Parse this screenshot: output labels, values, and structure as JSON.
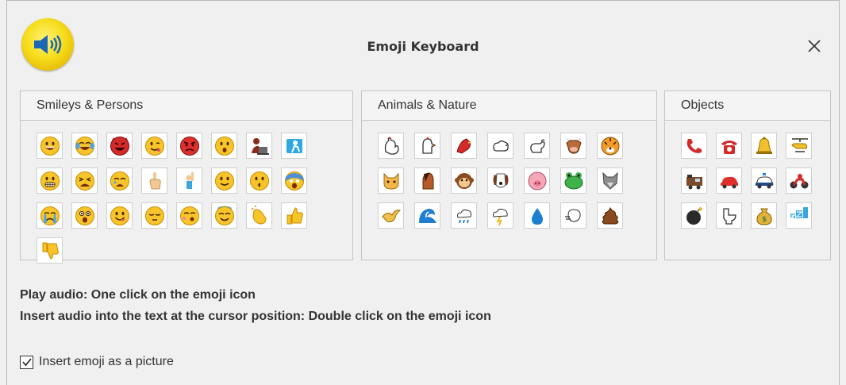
{
  "window": {
    "title": "Emoji Keyboard"
  },
  "panels": {
    "smileys": {
      "label": "Smileys & Persons",
      "items": [
        "grinning-face",
        "face-with-tears-of-joy",
        "smiling-face-with-horns",
        "winking-face",
        "angry-face",
        "hushed-face",
        "person-with-laptop",
        "person-walking",
        "grimacing-face",
        "tired-face",
        "weary-face",
        "raised-finger",
        "person-raising-hand",
        "slightly-smiling-face",
        "face-blowing-kiss",
        "face-screaming-in-fear",
        "crying-face",
        "astonished-face",
        "face-savoring-food",
        "pensive-face",
        "kissing-face",
        "smiling-face-with-halo",
        "clapping-hands",
        "thumbs-up",
        "thumbs-down"
      ]
    },
    "animals": {
      "label": "Animals & Nature",
      "items": [
        "rooster",
        "chicken",
        "cardinal-bird",
        "sheep",
        "goat",
        "cow",
        "tiger",
        "cat-face",
        "horse-face",
        "monkey-face",
        "dog-face",
        "pig-face",
        "frog-face",
        "wolf-face",
        "bird-flying",
        "water-wave",
        "cloud-with-rain",
        "cloud-with-lightning",
        "droplet",
        "wind-face",
        "pile-of-poo"
      ]
    },
    "objects": {
      "label": "Objects",
      "items": [
        "telephone-receiver",
        "telephone",
        "bell",
        "helicopter",
        "locomotive",
        "automobile",
        "police-car",
        "motorcycle",
        "bomb",
        "toilet",
        "money-bag",
        "zzz"
      ]
    }
  },
  "help": {
    "line1": "Play audio: One click on the emoji icon",
    "line2": "Insert audio into the text at the cursor position: Double click on the emoji icon"
  },
  "option": {
    "label": "Insert emoji as a picture",
    "checked": true
  },
  "colors": {
    "accent": "#f2d10f",
    "panel_border": "#c4c4c4"
  }
}
